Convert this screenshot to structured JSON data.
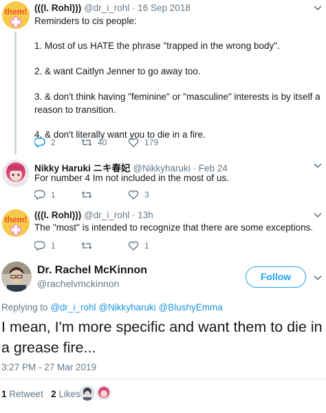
{
  "colors": {
    "link": "#1b95e0",
    "follow": "#1da1f2",
    "muted": "#657786"
  },
  "tweet1": {
    "name": "(((I. Rohl)))",
    "handle": "@dr_i_rohl",
    "date": "· 16 Sep 2018",
    "avatar_text": "them!",
    "lines": [
      "Reminders to cis people:",
      "1. Most of us HATE the phrase \"trapped in the wrong body\".",
      "2. & want Caitlyn Jenner to go away too.",
      "3. & don't think having \"feminine\" or \"masculine\" interests is by itself a reason to transition.",
      "4. & don't literally want you to die in a fire."
    ],
    "replies": "2",
    "retweets": "40",
    "likes": "179"
  },
  "tweet2": {
    "name": "Nikky Haruki ニキ春妃",
    "handle": "@Nikkyharuki",
    "date": "· Feb 24",
    "text": "For number 4 Im not included in the most of us.",
    "replies": "1",
    "retweets": "",
    "likes": "3"
  },
  "tweet3": {
    "name": "(((I. Rohl)))",
    "handle": "@dr_i_rohl",
    "date": "· 13h",
    "avatar_text": "them!",
    "text": "The \"most\" is intended to recognize that there are some exceptions.",
    "replies": "1",
    "retweets": "",
    "likes": "1"
  },
  "main": {
    "name": "Dr. Rachel McKinnon",
    "handle": "@rachelvmckinnon",
    "follow_label": "Follow",
    "replying_prefix": "Replying to",
    "replying_to": [
      "@dr_i_rohl",
      "@Nikkyharuki",
      "@BlushyEmma"
    ],
    "text": "I mean, I'm more specific and want them to die in a grease fire...",
    "timestamp": "3:27 PM - 27 Mar 2019",
    "retweet_count": "1",
    "retweet_label": "Retweet",
    "like_count": "2",
    "like_label": "Likes"
  }
}
